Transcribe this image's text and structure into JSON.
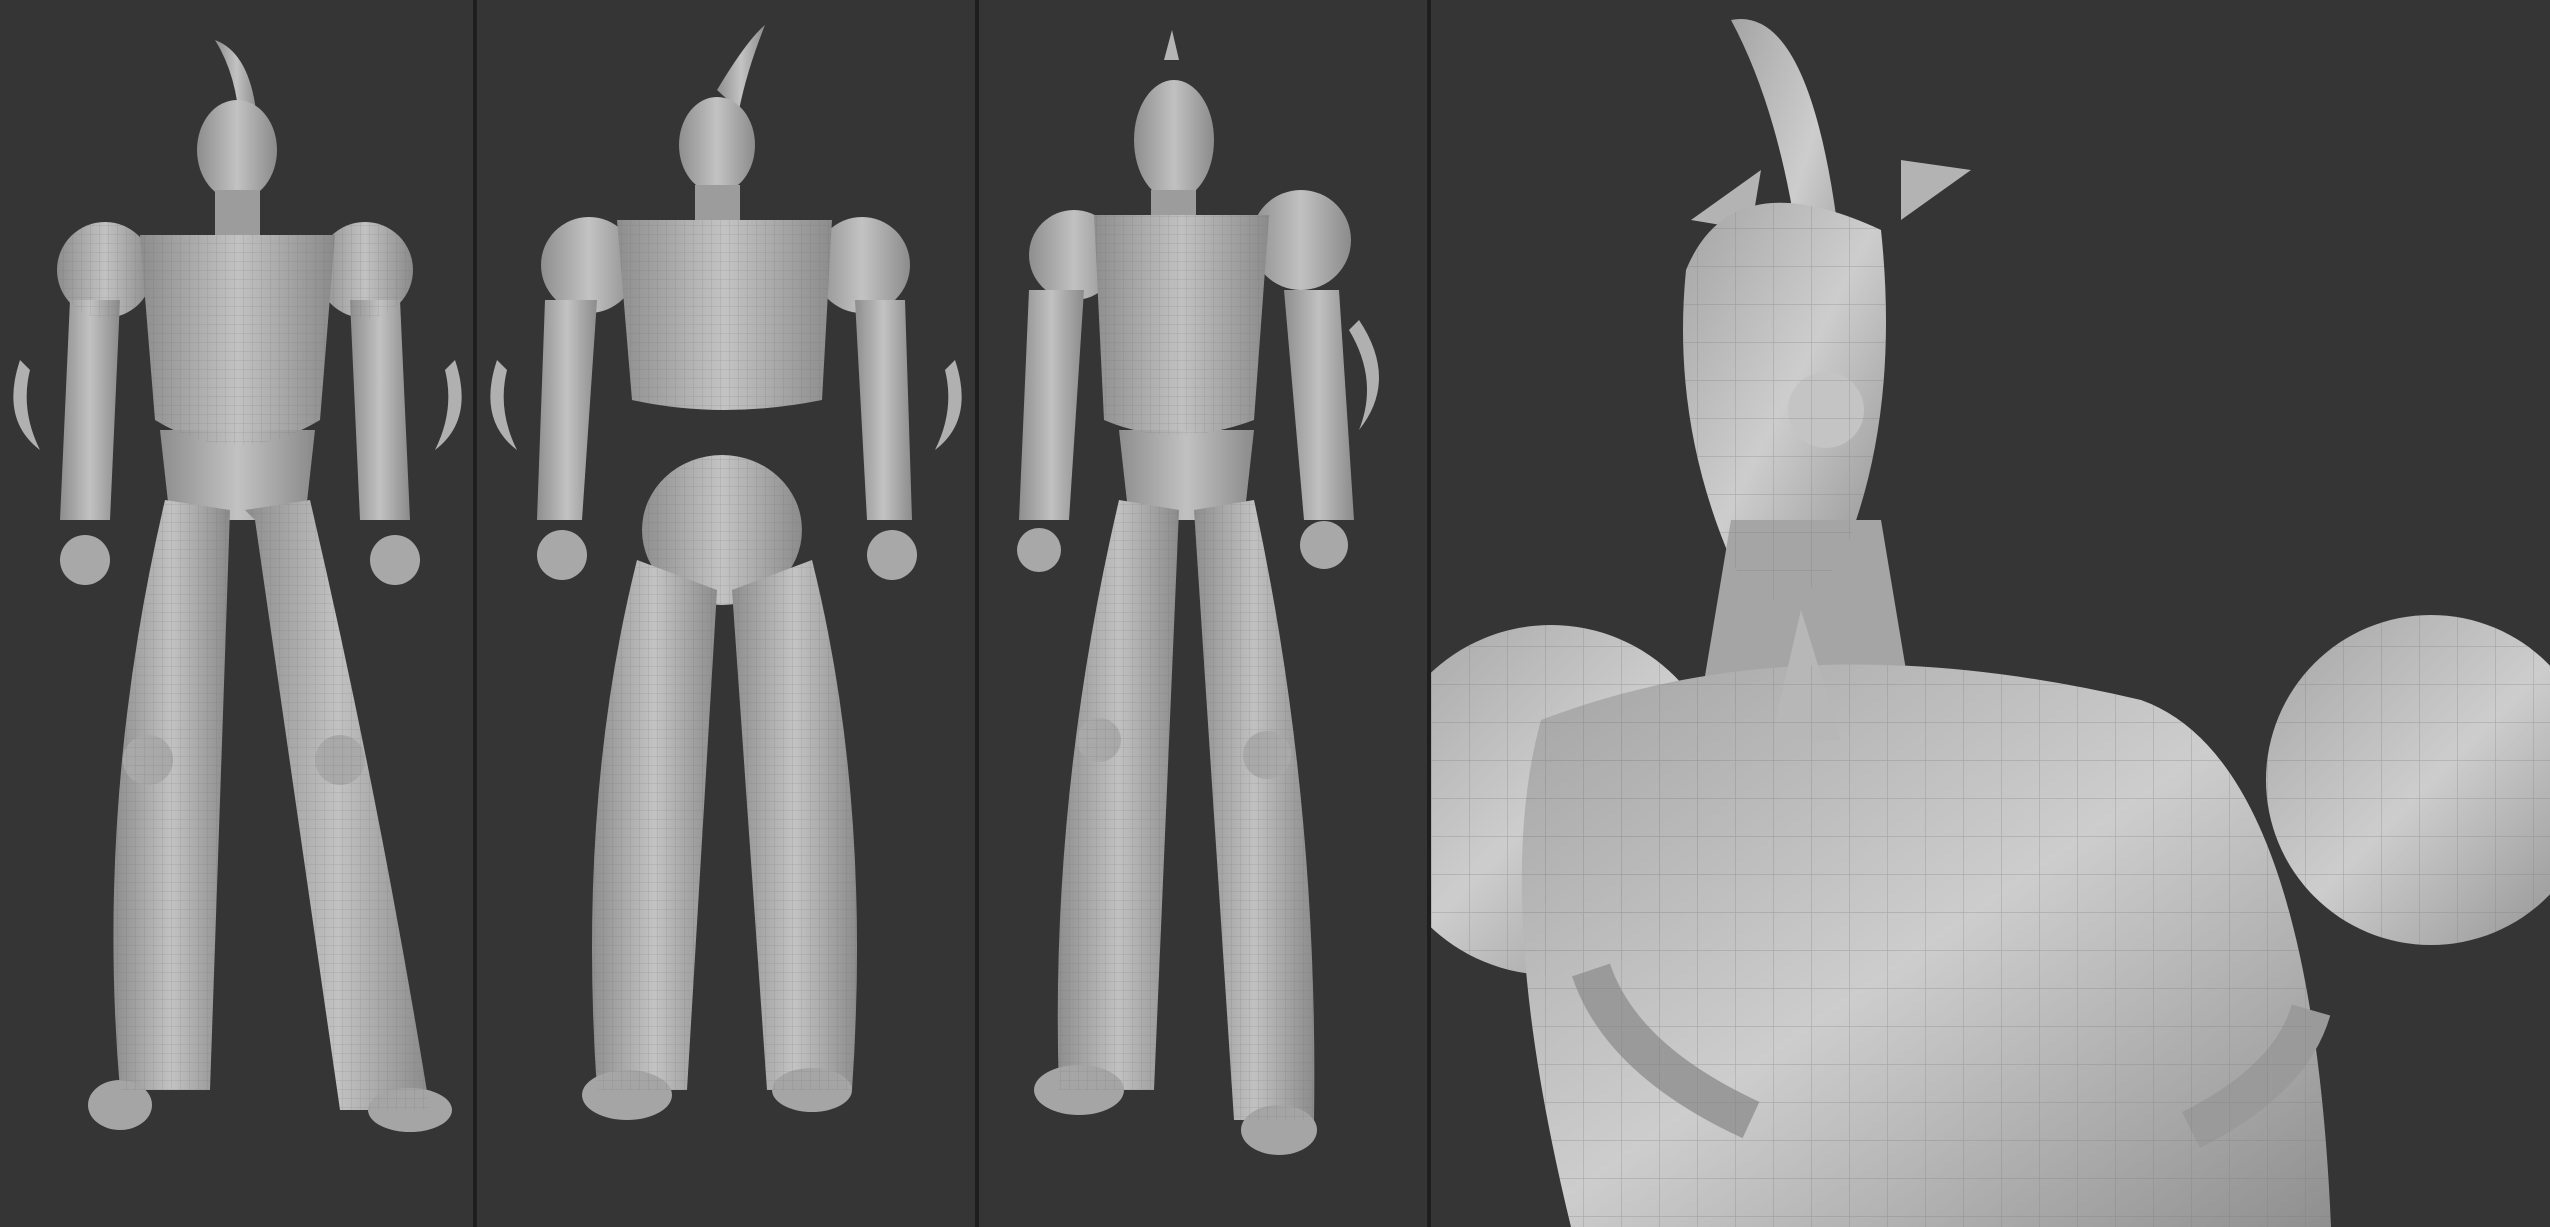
{
  "viewport": {
    "views": [
      {
        "id": "front",
        "view": "front"
      },
      {
        "id": "back",
        "view": "back"
      },
      {
        "id": "three-quarter",
        "view": "three-quarter"
      },
      {
        "id": "closeup",
        "view": "bust close-up"
      }
    ]
  },
  "colors": {
    "background": "#353536",
    "divider": "#1e1e1f",
    "model_light": "#b9b9b9",
    "model_mid": "#9a9a9a",
    "model_dark": "#6f6f6f",
    "wire": "#5e5e5e"
  }
}
